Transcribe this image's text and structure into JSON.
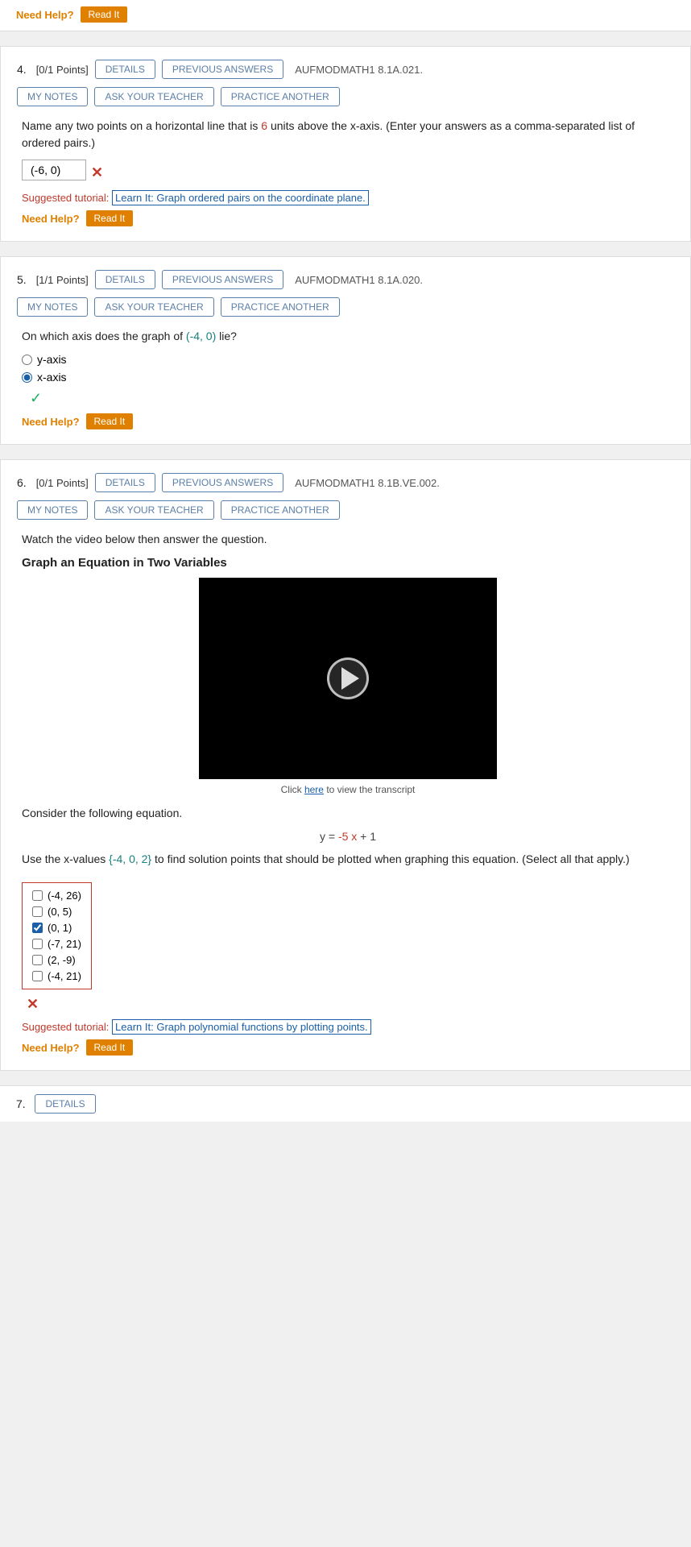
{
  "topStrip": {
    "needHelp": "Need Help?",
    "readIt": "Read It"
  },
  "questions": [
    {
      "id": "q4",
      "number": "4.",
      "points": "[0/1 Points]",
      "code": "AUFMODMATH1 8.1A.021.",
      "buttons": {
        "details": "DETAILS",
        "previousAnswers": "PREVIOUS ANSWERS",
        "myNotes": "MY NOTES",
        "askTeacher": "ASK YOUR TEACHER",
        "practiceAnother": "PRACTICE ANOTHER"
      },
      "questionText": "Name any two points on a horizontal line that is 6 units above the x-axis. (Enter your answers as a comma-separated list of ordered pairs.)",
      "highlightNumber": "6",
      "answer": "(-6, 0)",
      "wrongMark": "✕",
      "suggestedTutorial": {
        "label": "Suggested tutorial:",
        "link": "Learn It: Graph ordered pairs on the coordinate plane."
      },
      "needHelp": "Need Help?",
      "readIt": "Read It"
    },
    {
      "id": "q5",
      "number": "5.",
      "points": "[1/1 Points]",
      "code": "AUFMODMATH1 8.1A.020.",
      "buttons": {
        "details": "DETAILS",
        "previousAnswers": "PREVIOUS ANSWERS",
        "myNotes": "MY NOTES",
        "askTeacher": "ASK YOUR TEACHER",
        "practiceAnother": "PRACTICE ANOTHER"
      },
      "questionText": "On which axis does the graph of (-4, 0) lie?",
      "highlightCoord": "(-4, 0)",
      "radios": [
        {
          "value": "y-axis",
          "label": "y-axis",
          "checked": false
        },
        {
          "value": "x-axis",
          "label": "x-axis",
          "checked": true
        }
      ],
      "correctMark": "✓",
      "needHelp": "Need Help?",
      "readIt": "Read It"
    },
    {
      "id": "q6",
      "number": "6.",
      "points": "[0/1 Points]",
      "code": "AUFMODMATH1 8.1B.VE.002.",
      "buttons": {
        "details": "DETAILS",
        "previousAnswers": "PREVIOUS ANSWERS",
        "myNotes": "MY NOTES",
        "askTeacher": "ASK YOUR TEACHER",
        "practiceAnother": "PRACTICE ANOTHER"
      },
      "watchText": "Watch the video below then answer the question.",
      "videoTitle": "Graph an Equation in Two Variables",
      "transcriptText": "Click here to view the transcript",
      "considerText": "Consider the following equation.",
      "equation": "y = -5x + 1",
      "equationFormatted": "y = -5 x + 1",
      "useXValues": "Use the x-values {-4, 0, 2} to find solution points that should be plotted when graphing this equation. (Select all that apply.)",
      "xValsHighlight": "{-4, 0, 2}",
      "checkboxes": [
        {
          "label": "(-4, 26)",
          "checked": false
        },
        {
          "label": "(0, 5)",
          "checked": false
        },
        {
          "label": "(0, 1)",
          "checked": true
        },
        {
          "label": "(-7, 21)",
          "checked": false
        },
        {
          "label": "(2, -9)",
          "checked": false
        },
        {
          "label": "(-4, 21)",
          "checked": false
        }
      ],
      "wrongMark": "✕",
      "suggestedTutorial": {
        "label": "Suggested tutorial:",
        "link": "Learn It: Graph polynomial functions by plotting points."
      },
      "needHelp": "Need Help?",
      "readIt": "Read It"
    }
  ],
  "bottomStrip": {
    "number": "7.",
    "details": "DETAILS"
  }
}
